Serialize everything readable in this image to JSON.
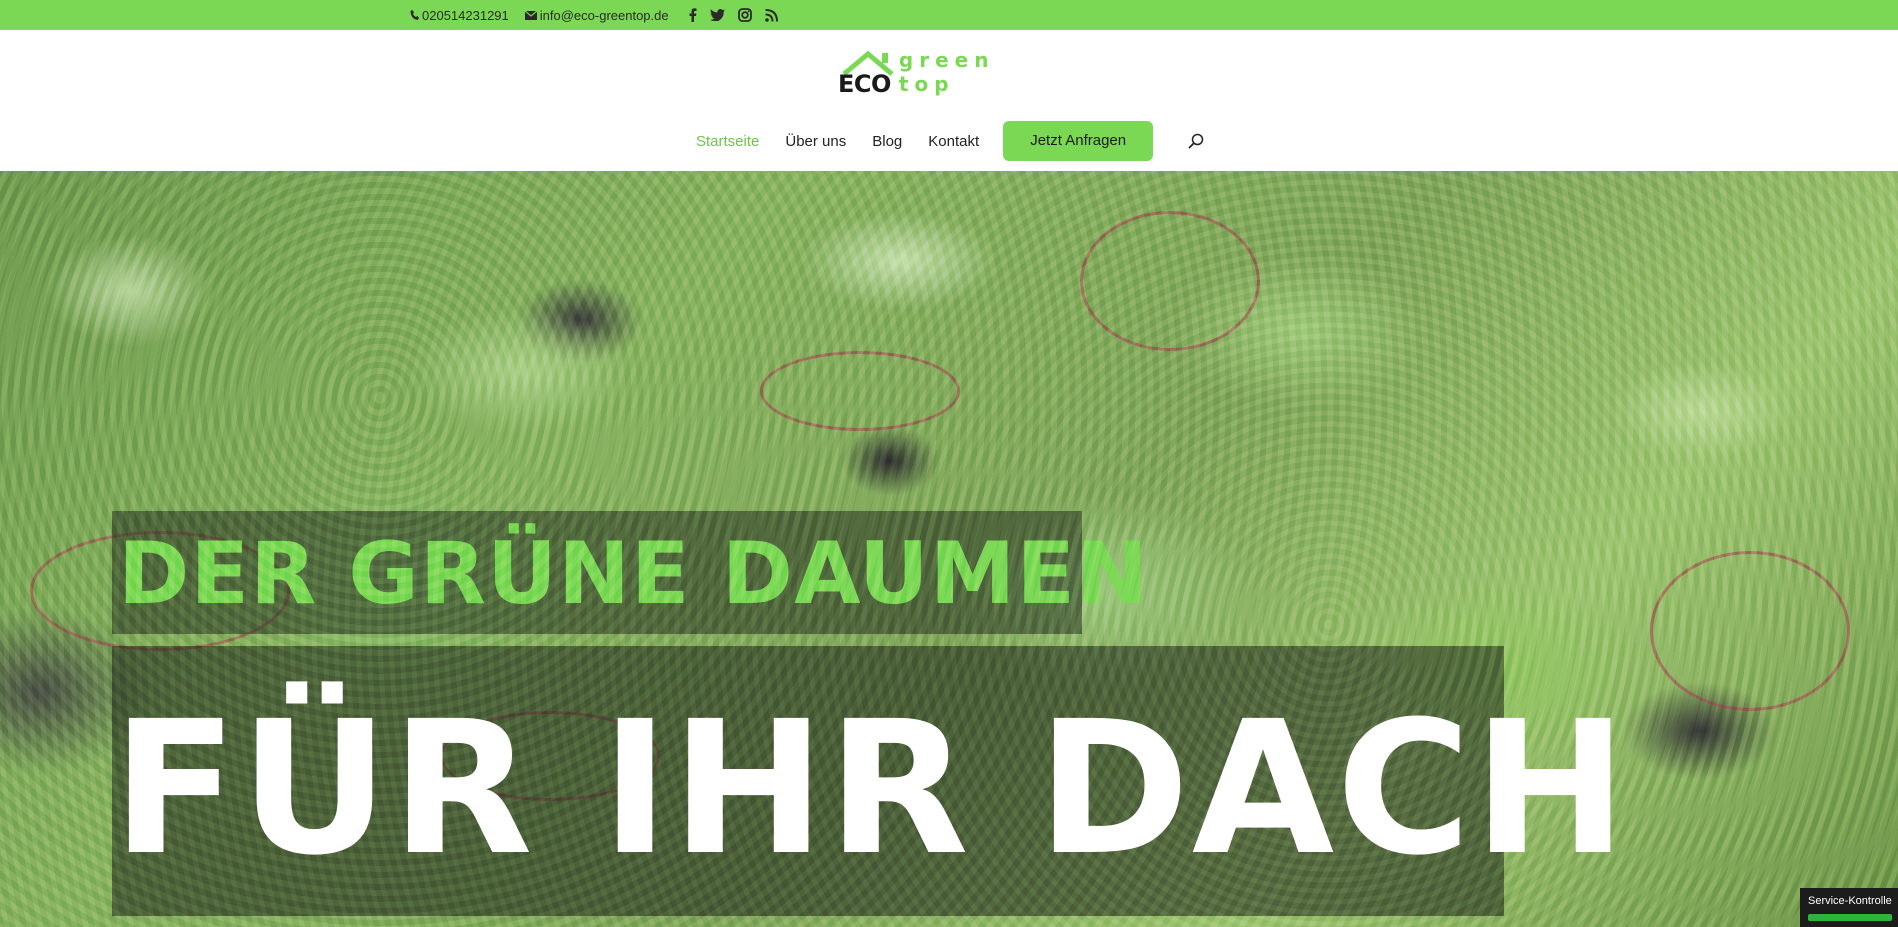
{
  "topbar": {
    "phone": "020514231291",
    "email": "info@eco-greentop.de",
    "social_icons": [
      "facebook-icon",
      "twitter-icon",
      "instagram-icon",
      "rss-icon"
    ]
  },
  "logo": {
    "eco": "ECO",
    "green_top": "green top"
  },
  "nav": {
    "items": [
      {
        "label": "Startseite",
        "active": true
      },
      {
        "label": "Über uns",
        "active": false
      },
      {
        "label": "Blog",
        "active": false
      },
      {
        "label": "Kontakt",
        "active": false
      }
    ],
    "cta_label": "Jetzt Anfragen"
  },
  "hero": {
    "headline_line1": "DER GRÜNE DAUMEN",
    "headline_line2": "FÜR IHR DACH"
  },
  "service_widget": {
    "label": "Service-Kontrolle"
  },
  "colors": {
    "accent_green": "#7bd855",
    "text_dark": "#222222",
    "white": "#ffffff"
  }
}
